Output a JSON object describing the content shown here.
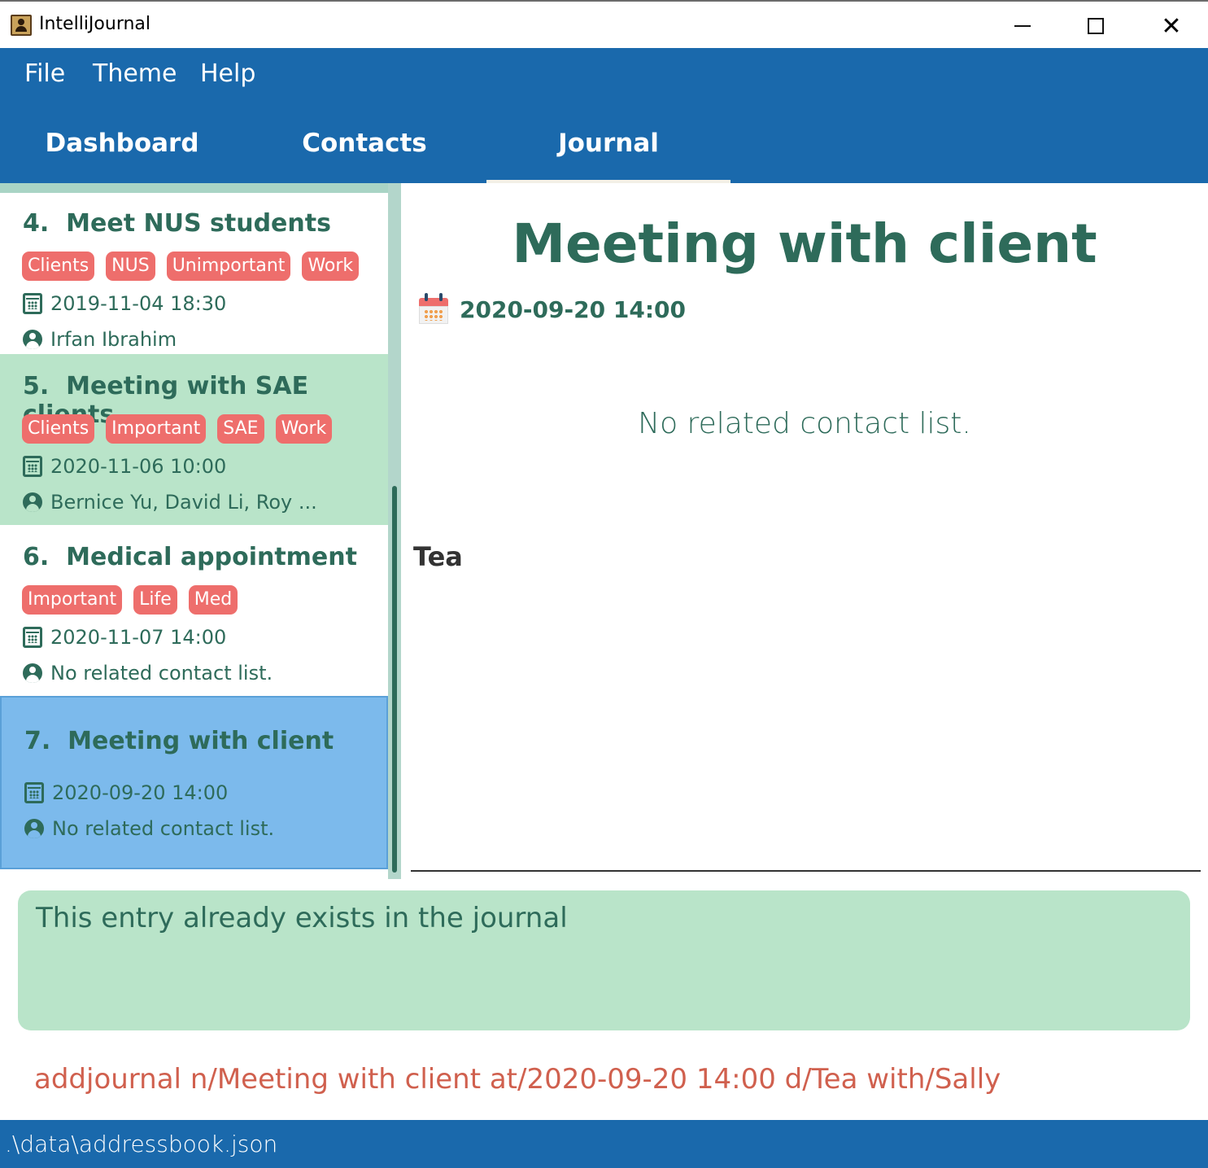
{
  "window": {
    "title": "IntelliJournal",
    "minimize": "—",
    "maximize": "☐",
    "close": "✕"
  },
  "menu": [
    "File",
    "Theme",
    "Help"
  ],
  "tabs": [
    {
      "label": "Dashboard",
      "active": false
    },
    {
      "label": "Contacts",
      "active": false
    },
    {
      "label": "Journal",
      "active": true
    }
  ],
  "journal_list": [
    {
      "index": "4.",
      "title": "Meet NUS students",
      "tags": [
        "Clients",
        "NUS",
        "Unimportant",
        "Work"
      ],
      "date": "2019-11-04 18:30",
      "contacts": "Irfan Ibrahim"
    },
    {
      "index": "5.",
      "title": "Meeting with SAE clients",
      "tags": [
        "Clients",
        "Important",
        "SAE",
        "Work"
      ],
      "date": "2020-11-06 10:00",
      "contacts": "Bernice Yu, David Li, Roy ..."
    },
    {
      "index": "6.",
      "title": "Medical appointment",
      "tags": [
        "Important",
        "Life",
        "Med"
      ],
      "date": "2020-11-07 14:00",
      "contacts": "No related contact list."
    },
    {
      "index": "7.",
      "title": "Meeting with client",
      "tags": [],
      "date": "2020-09-20 14:00",
      "contacts": "No related contact list."
    }
  ],
  "detail": {
    "title": "Meeting with client",
    "date": "2020-09-20 14:00",
    "contacts": "No related contact list.",
    "description": "Tea"
  },
  "result": "This entry already exists in the journal",
  "command": "addjournal n/Meeting with client at/2020-09-20 14:00 d/Tea with/Sally",
  "status": ".\\data\\addressbook.json",
  "colors": {
    "primary": "#1a69ac",
    "accent_green": "#b9e4c9",
    "selected_blue": "#7cbaec",
    "tag_red": "#ee6e6c",
    "text_green": "#2e6b5a"
  }
}
